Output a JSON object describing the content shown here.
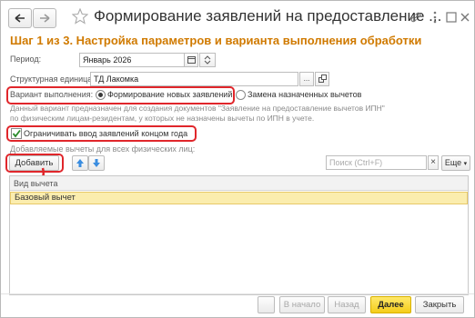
{
  "window": {
    "title": "Формирование заявлений на предоставление ...",
    "step_title": "Шаг 1 из 3. Настройка параметров и варианта выполнения обработки"
  },
  "form": {
    "period_label": "Период:",
    "period_value": "Январь 2026",
    "unit_label": "Структурная единица:",
    "unit_value": "ТД Лакомка",
    "unit_select_label": "...",
    "variant_label": "Вариант выполнения:",
    "variant_options": [
      "Формирование новых заявлений",
      "Замена назначенных вычетов"
    ],
    "hint_text": "Данный вариант предназначен для создания документов \"Заявление на предоставление вычетов ИПН\" по физическим лицам-резидентам, у которых не назначены вычеты по ИПН в учете.",
    "limit_checkbox_label": "Ограничивать ввод заявлений концом года",
    "limit_checked": true,
    "deductions_label": "Добавляемые вычеты для всех физических лиц:"
  },
  "toolbar": {
    "add_label": "Добавить",
    "search_placeholder": "Поиск (Ctrl+F)",
    "clear_label": "×",
    "more_label": "Еще"
  },
  "table": {
    "column": "Вид вычета",
    "rows": [
      "Базовый вычет"
    ]
  },
  "footer": {
    "start_label": "В начало",
    "back_label": "Назад",
    "next_label": "Далее",
    "close_label": "Закрыть"
  },
  "colors": {
    "step_title": "#d07a00",
    "highlight": "#e0262b",
    "primary_button": "#f4cd1a",
    "selected_row": "#fbedae"
  }
}
